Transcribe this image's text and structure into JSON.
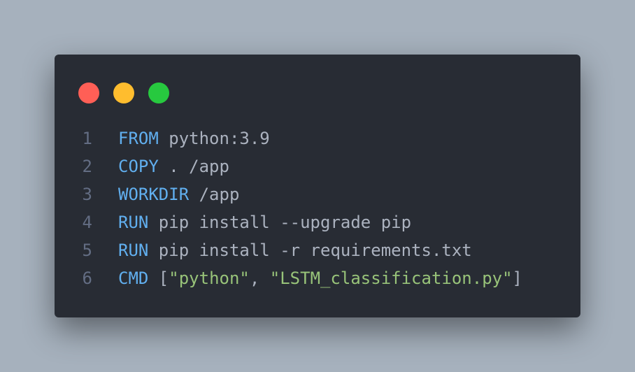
{
  "colors": {
    "background": "#a6b1bd",
    "window": "#282c34",
    "close": "#ff5f56",
    "minimize": "#ffbd2e",
    "maximize": "#27c93f",
    "keyword": "#61afef",
    "string": "#98c379",
    "text": "#abb2bf",
    "line_number": "#636d83"
  },
  "window_controls": {
    "close_icon": "red-dot",
    "minimize_icon": "yellow-dot",
    "maximize_icon": "green-dot"
  },
  "code": [
    {
      "num": "1",
      "parts": [
        {
          "t": "kw",
          "v": "FROM"
        },
        {
          "t": "plain",
          "v": " python:3.9"
        }
      ]
    },
    {
      "num": "2",
      "parts": [
        {
          "t": "kw",
          "v": "COPY"
        },
        {
          "t": "plain",
          "v": " . /app"
        }
      ]
    },
    {
      "num": "3",
      "parts": [
        {
          "t": "kw",
          "v": "WORKDIR"
        },
        {
          "t": "plain",
          "v": " /app"
        }
      ]
    },
    {
      "num": "4",
      "parts": [
        {
          "t": "kw",
          "v": "RUN"
        },
        {
          "t": "plain",
          "v": " pip install --upgrade pip"
        }
      ]
    },
    {
      "num": "5",
      "parts": [
        {
          "t": "kw",
          "v": "RUN"
        },
        {
          "t": "plain",
          "v": " pip install -r requirements.txt"
        }
      ]
    },
    {
      "num": "6",
      "parts": [
        {
          "t": "kw",
          "v": "CMD"
        },
        {
          "t": "plain",
          "v": " ["
        },
        {
          "t": "str",
          "v": "\"python\""
        },
        {
          "t": "plain",
          "v": ", "
        },
        {
          "t": "str",
          "v": "\"LSTM_classification.py\""
        },
        {
          "t": "plain",
          "v": "]"
        }
      ]
    }
  ]
}
